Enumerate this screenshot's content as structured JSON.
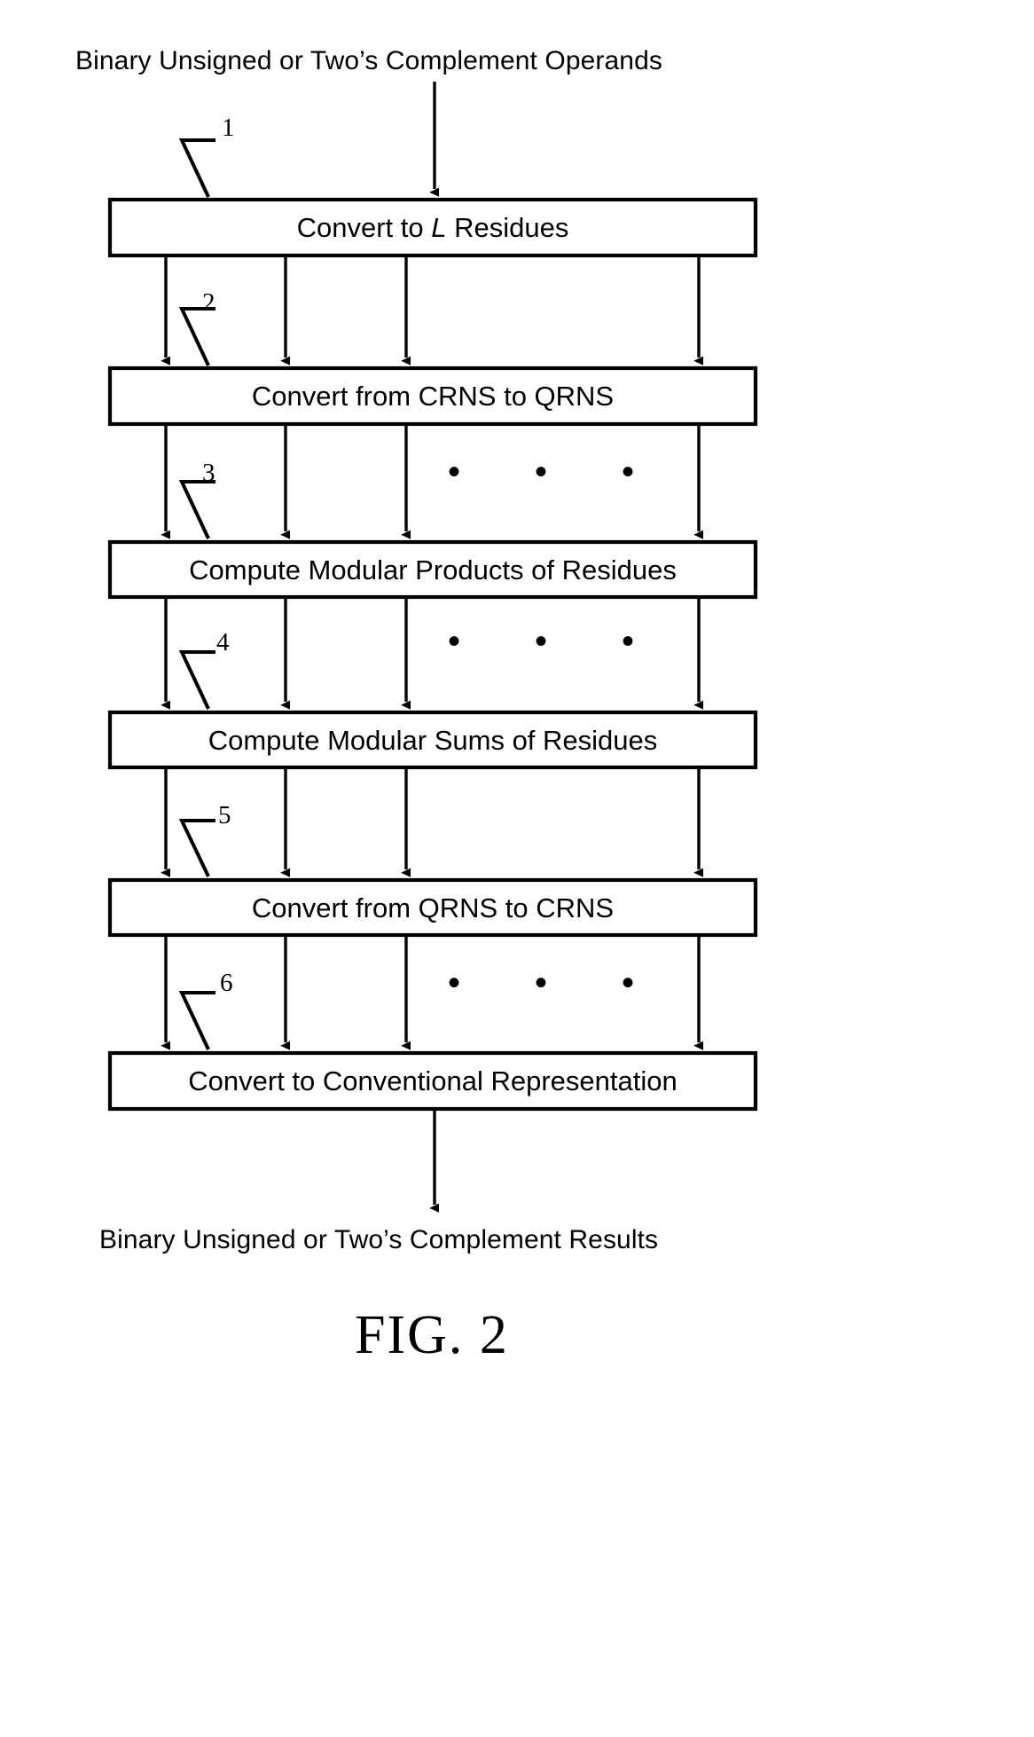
{
  "figure": {
    "label": "FIG. 2",
    "input_caption": "Binary Unsigned or Two’s Complement Operands",
    "output_caption": "Binary Unsigned or Two’s Complement Results",
    "line_color": "#000000",
    "background_color": "#ffffff"
  },
  "steps": [
    {
      "ref": "1",
      "text_before": "Convert to ",
      "emphasis": "L",
      "text_after": " Residues",
      "full_text": "Convert to L Residues"
    },
    {
      "ref": "2",
      "text_before": "Convert from CRNS to QRNS",
      "emphasis": "",
      "text_after": "",
      "full_text": "Convert from CRNS to QRNS"
    },
    {
      "ref": "3",
      "text_before": "Compute Modular Products of Residues",
      "emphasis": "",
      "text_after": "",
      "full_text": "Compute Modular Products of Residues"
    },
    {
      "ref": "4",
      "text_before": "Compute Modular Sums of Residues",
      "emphasis": "",
      "text_after": "",
      "full_text": "Compute Modular Sums of Residues"
    },
    {
      "ref": "5",
      "text_before": "Convert from QRNS to CRNS",
      "emphasis": "",
      "text_after": "",
      "full_text": "Convert from QRNS to CRNS"
    },
    {
      "ref": "6",
      "text_before": "Convert to Conventional Representation",
      "emphasis": "",
      "text_after": "",
      "full_text": "Convert to Conventional Representation"
    }
  ],
  "ellipses": [
    {
      "after_step": "2",
      "glyph": "• • •"
    },
    {
      "after_step": "3",
      "glyph": "• • •"
    },
    {
      "after_step": "5",
      "glyph": "• • •"
    }
  ]
}
